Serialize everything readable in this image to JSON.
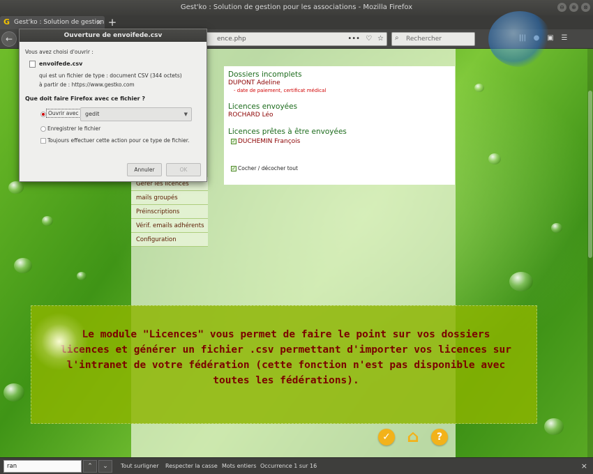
{
  "window": {
    "title": "Gest'ko : Solution de gestion pour les associations - Mozilla Firefox",
    "buttons": [
      "⊖",
      "⊕",
      "⊗"
    ]
  },
  "tab": {
    "label": "Gest'ko : Solution de gestion po",
    "favicon": "G",
    "close": "×",
    "new": "+"
  },
  "nav": {
    "back": "←",
    "url_visible": "ence.php",
    "url_icons": [
      "•••",
      "♡",
      "☆"
    ],
    "search_placeholder": "Rechercher",
    "toolbar_icons": [
      "|||",
      "●",
      "▣",
      "☰"
    ]
  },
  "dialog": {
    "title": "Ouverture de envoifede.csv",
    "intro": "Vous avez choisi d'ouvrir :",
    "filename": "envoifede.csv",
    "type_line": "qui est un fichier de type :  document CSV (344 octets)",
    "from_line": "à partir de : https://www.gestko.com",
    "question": "Que doit faire Firefox avec ce fichier ?",
    "open_with_label": "Ouvrir avec",
    "open_with_app": "gedit",
    "save_label": "Enregistrer le fichier",
    "always_label": "Toujours effectuer cette action pour ce type de fichier.",
    "cancel": "Annuler",
    "ok": "OK"
  },
  "panel": {
    "incomplete_title": "Dossiers incomplets",
    "incomplete_name": "DUPONT Adeline",
    "incomplete_note": "- date de paiement, certificat médical",
    "sent_title": "Licences envoyées",
    "sent_name": "ROCHARD Léo",
    "ready_title": "Licences prêtes à être envoyées",
    "ready_name": "DUCHEMIN François",
    "toggle_all": "Cocher / décocher tout"
  },
  "menu": [
    "Gérer les licences",
    "mails groupés",
    "Préinscriptions",
    "Vérif. emails adhérents",
    "Configuration"
  ],
  "info": {
    "text": "Le module \"Licences\" vous permet de faire le point sur vos dossiers licences et générer un fichier .csv permettant d'importer vos licences sur l'intranet de votre fédération (cette fonction n'est pas disponible avec toutes les fédérations)."
  },
  "icons": {
    "check": "✓",
    "home": "⌂",
    "help": "?"
  },
  "findbar": {
    "value": "ran",
    "up": "⌃",
    "down": "⌄",
    "highlight_all": "Tout surligner",
    "match_case": "Respecter la casse",
    "whole_words": "Mots entiers",
    "status": "Occurrence 1 sur 16",
    "close": "×"
  },
  "colors": {
    "accent_green": "#1c6b1c",
    "name_red": "#8b0000",
    "info_bg": "#8cb400",
    "button_gold": "#f2b21a"
  }
}
